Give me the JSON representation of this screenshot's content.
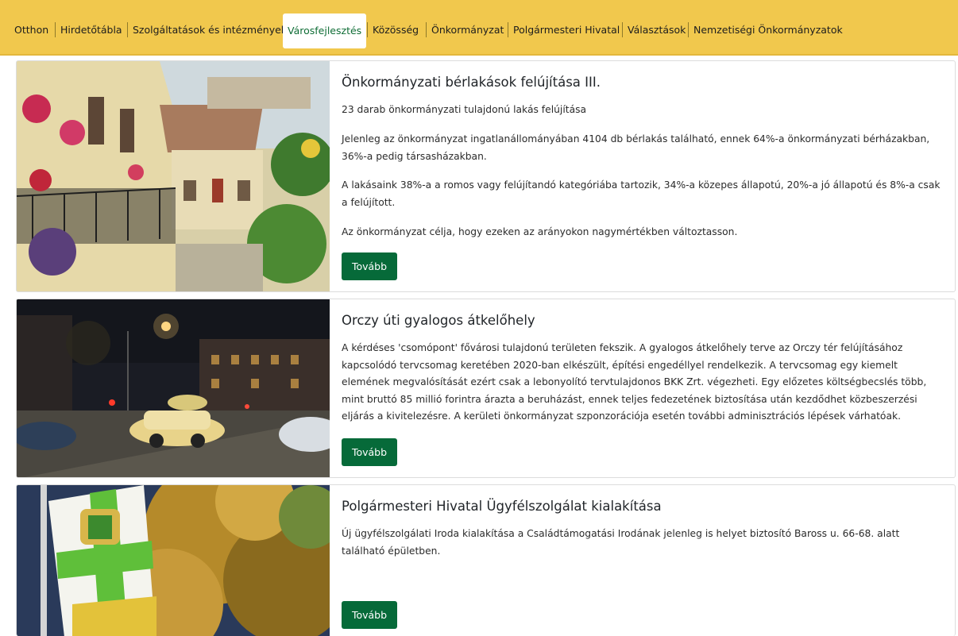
{
  "nav": {
    "items": [
      {
        "label": "Otthon"
      },
      {
        "label": "Hirdetőtábla"
      },
      {
        "label": "Szolgáltatások és intézmények"
      },
      {
        "label": "Városfejlesztés",
        "active": true
      },
      {
        "label": "Közösség"
      },
      {
        "label": "Önkormányzat"
      },
      {
        "label": "Polgármesteri Hivatal"
      },
      {
        "label": "Választások"
      },
      {
        "label": "Nemzetiségi Önkormányzatok"
      }
    ],
    "colors": {
      "bar": "#f1c84d",
      "active_text": "#0f6d36"
    }
  },
  "articles": [
    {
      "title": "Önkormányzati bérlakások felújítása III.",
      "paragraphs": [
        "23 darab önkormányzati tulajdonú lakás felújítása",
        "Jelenleg az önkormányzat ingatlanállományában 4104 db bérlakás található, ennek 64%-a önkormányzati bérházakban, 36%-a pedig társasházakban.",
        "A lakásaink 38%-a a romos vagy felújítandó kategóriába tartozik, 34%-a közepes állapotú, 20%-a jó állapotú és 8%-a csak a felújított.",
        "Az önkormányzat célja, hogy ezeken az arányokon nagymértékben változtasson."
      ],
      "button_label": "Tovább"
    },
    {
      "title": "Orczy úti gyalogos átkelőhely",
      "paragraphs": [
        "A kérdéses 'csomópont' fővárosi tulajdonú területen fekszik. A gyalogos átkelőhely terve az Orczy tér felújításához kapcsolódó tervcsomag keretében 2020-ban elkészült, építési engedéllyel rendelkezik.  A tervcsomag egy kiemelt elemének megvalósítását ezért csak a lebonyolító tervtulajdonos BKK Zrt. végezheti. Egy előzetes költségbecslés több, mint bruttó 85 millió forintra árazta a beruházást, ennek teljes fedezetének biztosítása után kezdődhet közbeszerzési eljárás a kivitelezésre. A kerületi önkormányzat szponzorációja esetén további adminisztrációs lépések várhatóak."
      ],
      "button_label": "Tovább"
    },
    {
      "title": "Polgármesteri Hivatal Ügyfélszolgálat kialakítása",
      "paragraphs": [
        "Új ügyfélszolgálati Iroda kialakítása a Családtámogatási Irodának jelenleg is helyet biztosító Baross u. 66-68. alatt található épületben."
      ],
      "button_label": "Tovább"
    }
  ],
  "theme": {
    "button": "#066a39",
    "border": "#dcdcdc"
  }
}
